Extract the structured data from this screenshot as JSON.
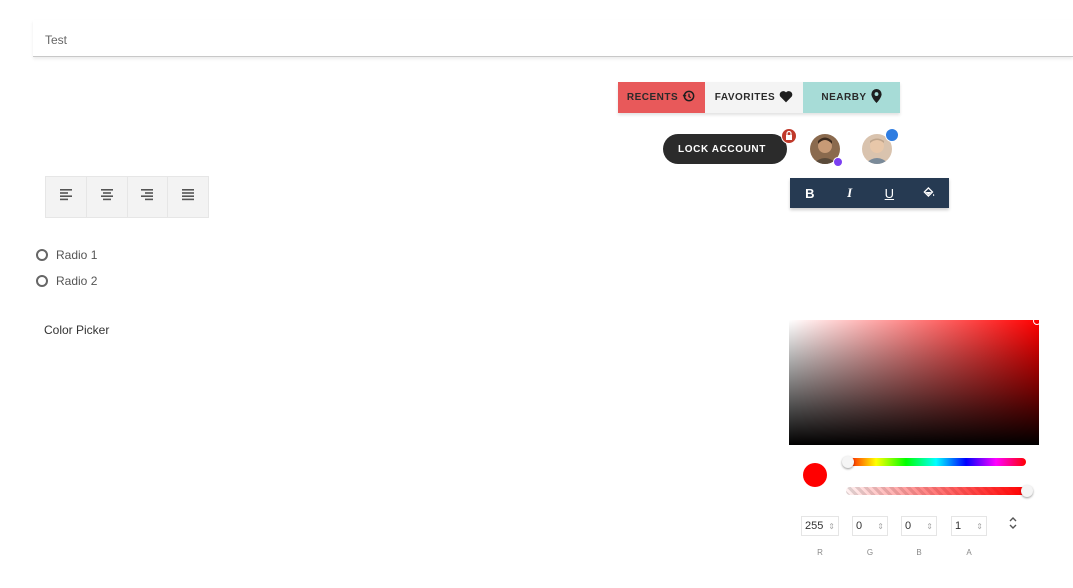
{
  "text_field": {
    "value": "Test"
  },
  "toggle_group": {
    "buttons": [
      {
        "label": "RECENTS",
        "icon": "history-icon",
        "color": "#e8595a"
      },
      {
        "label": "FAVORITES",
        "icon": "heart-icon",
        "color": "#f4f4f4"
      },
      {
        "label": "NEARBY",
        "icon": "location-pin-icon",
        "color": "#a7dcd7"
      }
    ]
  },
  "lock_chip": {
    "label": "LOCK ACCOUNT",
    "badge_icon": "lock-icon"
  },
  "avatars": [
    {
      "name": "avatar-1",
      "status_color": "#7b3ff2"
    },
    {
      "name": "avatar-2",
      "status_color": "#2f7de1"
    }
  ],
  "format_toolbar": {
    "bold": "B",
    "italic": "I",
    "underline": "U",
    "fill_icon": "paint-bucket-icon",
    "background": "#263a52"
  },
  "alignment_group": [
    "align-left-icon",
    "align-center-icon",
    "align-right-icon",
    "align-justify-icon"
  ],
  "radios": [
    {
      "label": "Radio 1"
    },
    {
      "label": "Radio 2"
    }
  ],
  "color_picker": {
    "label": "Color Picker",
    "selected_color": "#ff0000",
    "inputs": {
      "r": {
        "value": "255",
        "label": "R"
      },
      "g": {
        "value": "0",
        "label": "G"
      },
      "b": {
        "value": "0",
        "label": "B"
      },
      "a": {
        "value": "1",
        "label": "A"
      }
    },
    "mode_switch_icon": "unfold-icon"
  }
}
